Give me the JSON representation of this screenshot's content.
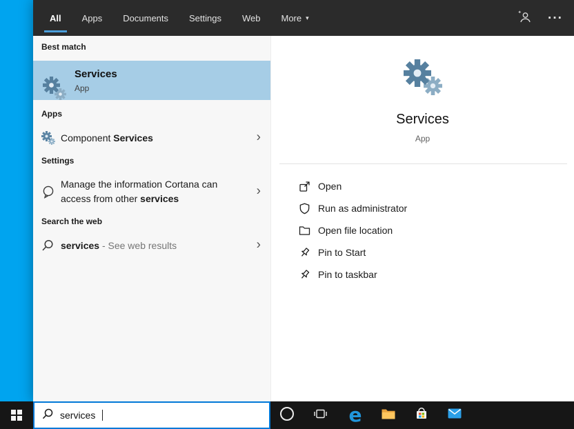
{
  "colors": {
    "desktop": "#00a4ef",
    "topbar_bg": "#2b2b2b",
    "accent_underline": "#4a9edb",
    "highlight": "#a6cde6",
    "left_bg": "#f7f7f7",
    "right_bg": "#ffffff",
    "taskbar_bg": "#161616",
    "search_border": "#0078d7"
  },
  "topbar": {
    "tabs": [
      "All",
      "Apps",
      "Documents",
      "Settings",
      "Web",
      "More"
    ]
  },
  "icons": {
    "caret_down": "▾",
    "ellipsis": "···",
    "chevron_right": "›",
    "edge_glyph": "e"
  },
  "left": {
    "best_match_header": "Best match",
    "best_match": {
      "title": "Services",
      "subtitle": "App"
    },
    "apps_header": "Apps",
    "component": {
      "prefix": "Component ",
      "match": "Services"
    },
    "settings_header": "Settings",
    "cortana": {
      "line1": "Manage the information Cortana can",
      "line2_prefix": "access from other ",
      "line2_match": "services"
    },
    "web_header": "Search the web",
    "web": {
      "match": "services",
      "suffix": " - See web results"
    }
  },
  "right": {
    "title": "Services",
    "subtitle": "App",
    "actions": [
      {
        "label": "Open"
      },
      {
        "label": "Run as administrator"
      },
      {
        "label": "Open file location"
      },
      {
        "label": "Pin to Start"
      },
      {
        "label": "Pin to taskbar"
      }
    ]
  },
  "taskbar": {
    "search_value": "services"
  }
}
